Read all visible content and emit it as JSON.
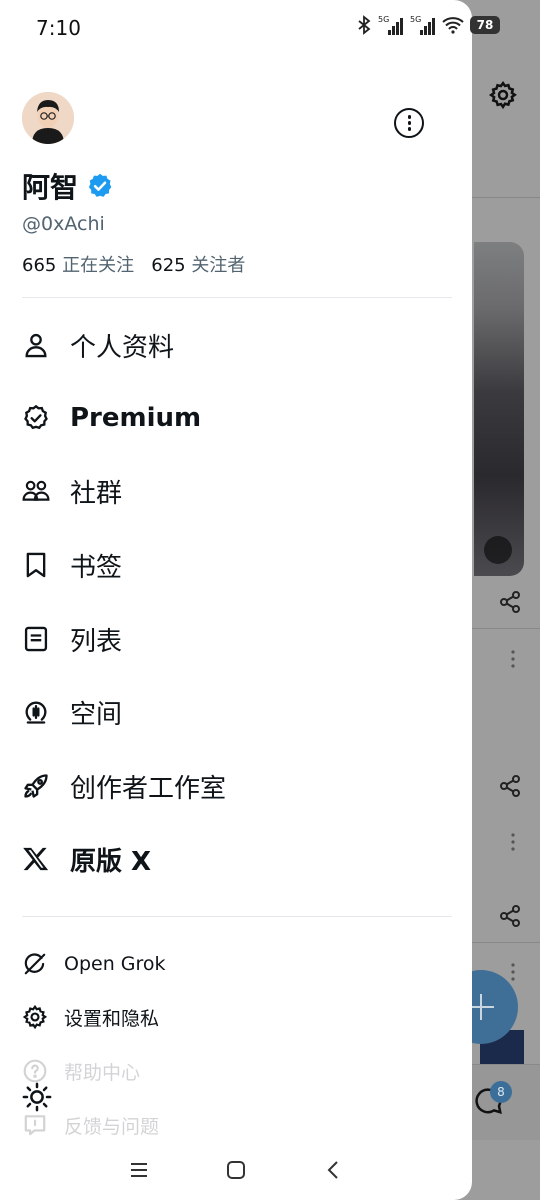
{
  "status_bar": {
    "time": "7:10",
    "battery": "78",
    "network_1": "5G",
    "network_2": "5G"
  },
  "profile": {
    "name": "阿智",
    "handle": "@0xAchi",
    "following_count": "665",
    "following_label": "正在关注",
    "followers_count": "625",
    "followers_label": "关注者"
  },
  "menu": {
    "items": [
      {
        "label": "个人资料",
        "icon": "person-icon"
      },
      {
        "label": "Premium",
        "icon": "premium-badge-icon"
      },
      {
        "label": "社群",
        "icon": "communities-icon"
      },
      {
        "label": "书签",
        "icon": "bookmark-icon"
      },
      {
        "label": "列表",
        "icon": "list-icon"
      },
      {
        "label": "空间",
        "icon": "spaces-icon"
      },
      {
        "label": "创作者工作室",
        "icon": "rocket-icon"
      },
      {
        "label": "原版 X",
        "icon": "x-logo-icon"
      }
    ],
    "secondary": [
      {
        "label": "Open Grok",
        "icon": "grok-icon"
      },
      {
        "label": "设置和隐私",
        "icon": "gear-icon"
      },
      {
        "label": "帮助中心",
        "icon": "help-icon"
      },
      {
        "label": "反馈与问题",
        "icon": "feedback-icon"
      }
    ]
  },
  "background": {
    "messages_badge": "8"
  },
  "colors": {
    "verified": "#1d9bf0",
    "text": "#0f1419",
    "secondary_text": "#536471"
  }
}
